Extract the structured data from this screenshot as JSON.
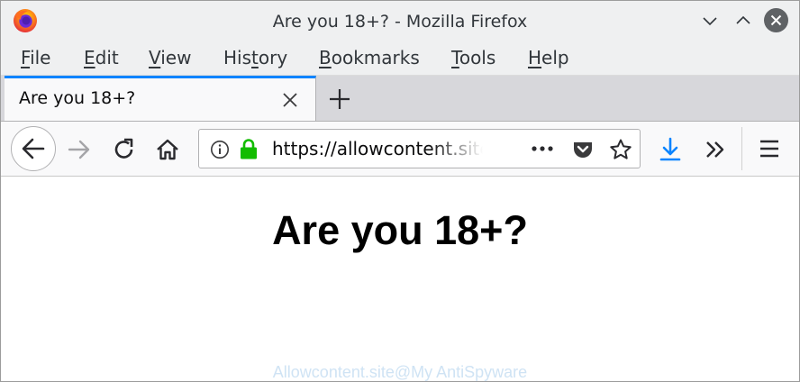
{
  "window": {
    "title": "Are you 18+? - Mozilla Firefox"
  },
  "menubar": {
    "items": [
      {
        "label": "File",
        "accel": "F",
        "rest": "ile"
      },
      {
        "label": "Edit",
        "accel": "E",
        "rest": "dit"
      },
      {
        "label": "View",
        "accel": "V",
        "rest": "iew"
      },
      {
        "label": "History",
        "pre": "His",
        "accel": "t",
        "rest": "ory"
      },
      {
        "label": "Bookmarks",
        "accel": "B",
        "rest": "ookmarks"
      },
      {
        "label": "Tools",
        "accel": "T",
        "rest": "ools"
      },
      {
        "label": "Help",
        "accel": "H",
        "rest": "elp"
      }
    ]
  },
  "tabs": [
    {
      "title": "Are you 18+?",
      "active": true
    }
  ],
  "urlbar": {
    "url": "https://allowcontent.site"
  },
  "page": {
    "heading": "Are you 18+?",
    "watermark": "Allowcontent.site@My AntiSpyware"
  },
  "icons": {
    "app": "firefox-logo-icon",
    "minimize": "chevron-down-icon",
    "maximize": "chevron-up-icon",
    "close": "close-circle-icon",
    "tab_close": "close-icon",
    "new_tab": "plus-icon",
    "back": "back-arrow-icon",
    "forward": "forward-arrow-icon",
    "reload": "reload-icon",
    "home": "home-icon",
    "info": "info-icon",
    "lock": "lock-icon",
    "page_actions": "more-dots-icon",
    "pocket": "pocket-icon",
    "bookmark": "star-icon",
    "downloads": "download-arrow-icon",
    "overflow": "double-chevron-icon",
    "menu": "hamburger-menu-icon"
  },
  "colors": {
    "tab_accent": "#0a84ff",
    "download_icon": "#0a84ff",
    "lock": "#12bc00",
    "chrome_bg": "#eff0f1",
    "watermark": "#cfe3f4"
  }
}
